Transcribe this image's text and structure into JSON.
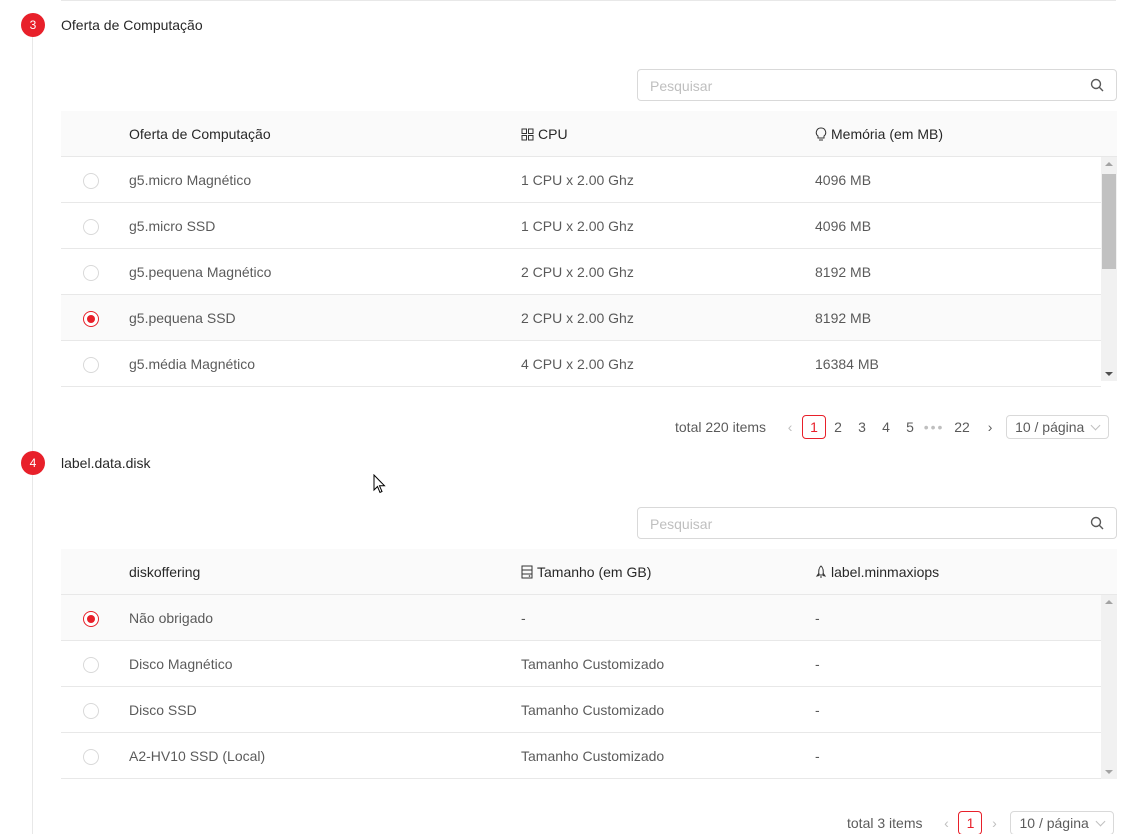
{
  "steps": {
    "compute": {
      "number": "3",
      "title": "Oferta de Computação",
      "search_placeholder": "Pesquisar",
      "columns": [
        "Oferta de Computação",
        "CPU",
        "Memória (em MB)"
      ],
      "column_icons": [
        "",
        "grid-icon",
        "bulb-icon"
      ],
      "rows": [
        {
          "name": "g5.micro Magnético",
          "cpu": "1 CPU x 2.00 Ghz",
          "memory": "4096 MB",
          "selected": false
        },
        {
          "name": "g5.micro SSD",
          "cpu": "1 CPU x 2.00 Ghz",
          "memory": "4096 MB",
          "selected": false
        },
        {
          "name": "g5.pequena Magnético",
          "cpu": "2 CPU x 2.00 Ghz",
          "memory": "8192 MB",
          "selected": false
        },
        {
          "name": "g5.pequena SSD",
          "cpu": "2 CPU x 2.00 Ghz",
          "memory": "8192 MB",
          "selected": true
        },
        {
          "name": "g5.média Magnético",
          "cpu": "4 CPU x 2.00 Ghz",
          "memory": "16384 MB",
          "selected": false
        }
      ],
      "pagination": {
        "total": "total 220 items",
        "pages": [
          "1",
          "2",
          "3",
          "4",
          "5"
        ],
        "ellipsis": "•••",
        "last": "22",
        "current": "1",
        "page_size": "10 / página"
      }
    },
    "disk": {
      "number": "4",
      "title": "label.data.disk",
      "search_placeholder": "Pesquisar",
      "columns": [
        "diskoffering",
        "Tamanho (em GB)",
        "label.minmaxiops"
      ],
      "column_icons": [
        "",
        "hdd-icon",
        "rocket-icon"
      ],
      "rows": [
        {
          "name": "Não obrigado",
          "size": "-",
          "iops": "-",
          "selected": true
        },
        {
          "name": "Disco Magnético",
          "size": "Tamanho Customizado",
          "iops": "-",
          "selected": false
        },
        {
          "name": "Disco SSD",
          "size": "Tamanho Customizado",
          "iops": "-",
          "selected": false
        },
        {
          "name": "A2-HV10 SSD (Local)",
          "size": "Tamanho Customizado",
          "iops": "-",
          "selected": false
        }
      ],
      "pagination": {
        "total": "total 3 items",
        "current": "1",
        "page_size": "10 / página"
      }
    }
  },
  "colors": {
    "accent": "#e8202a"
  }
}
